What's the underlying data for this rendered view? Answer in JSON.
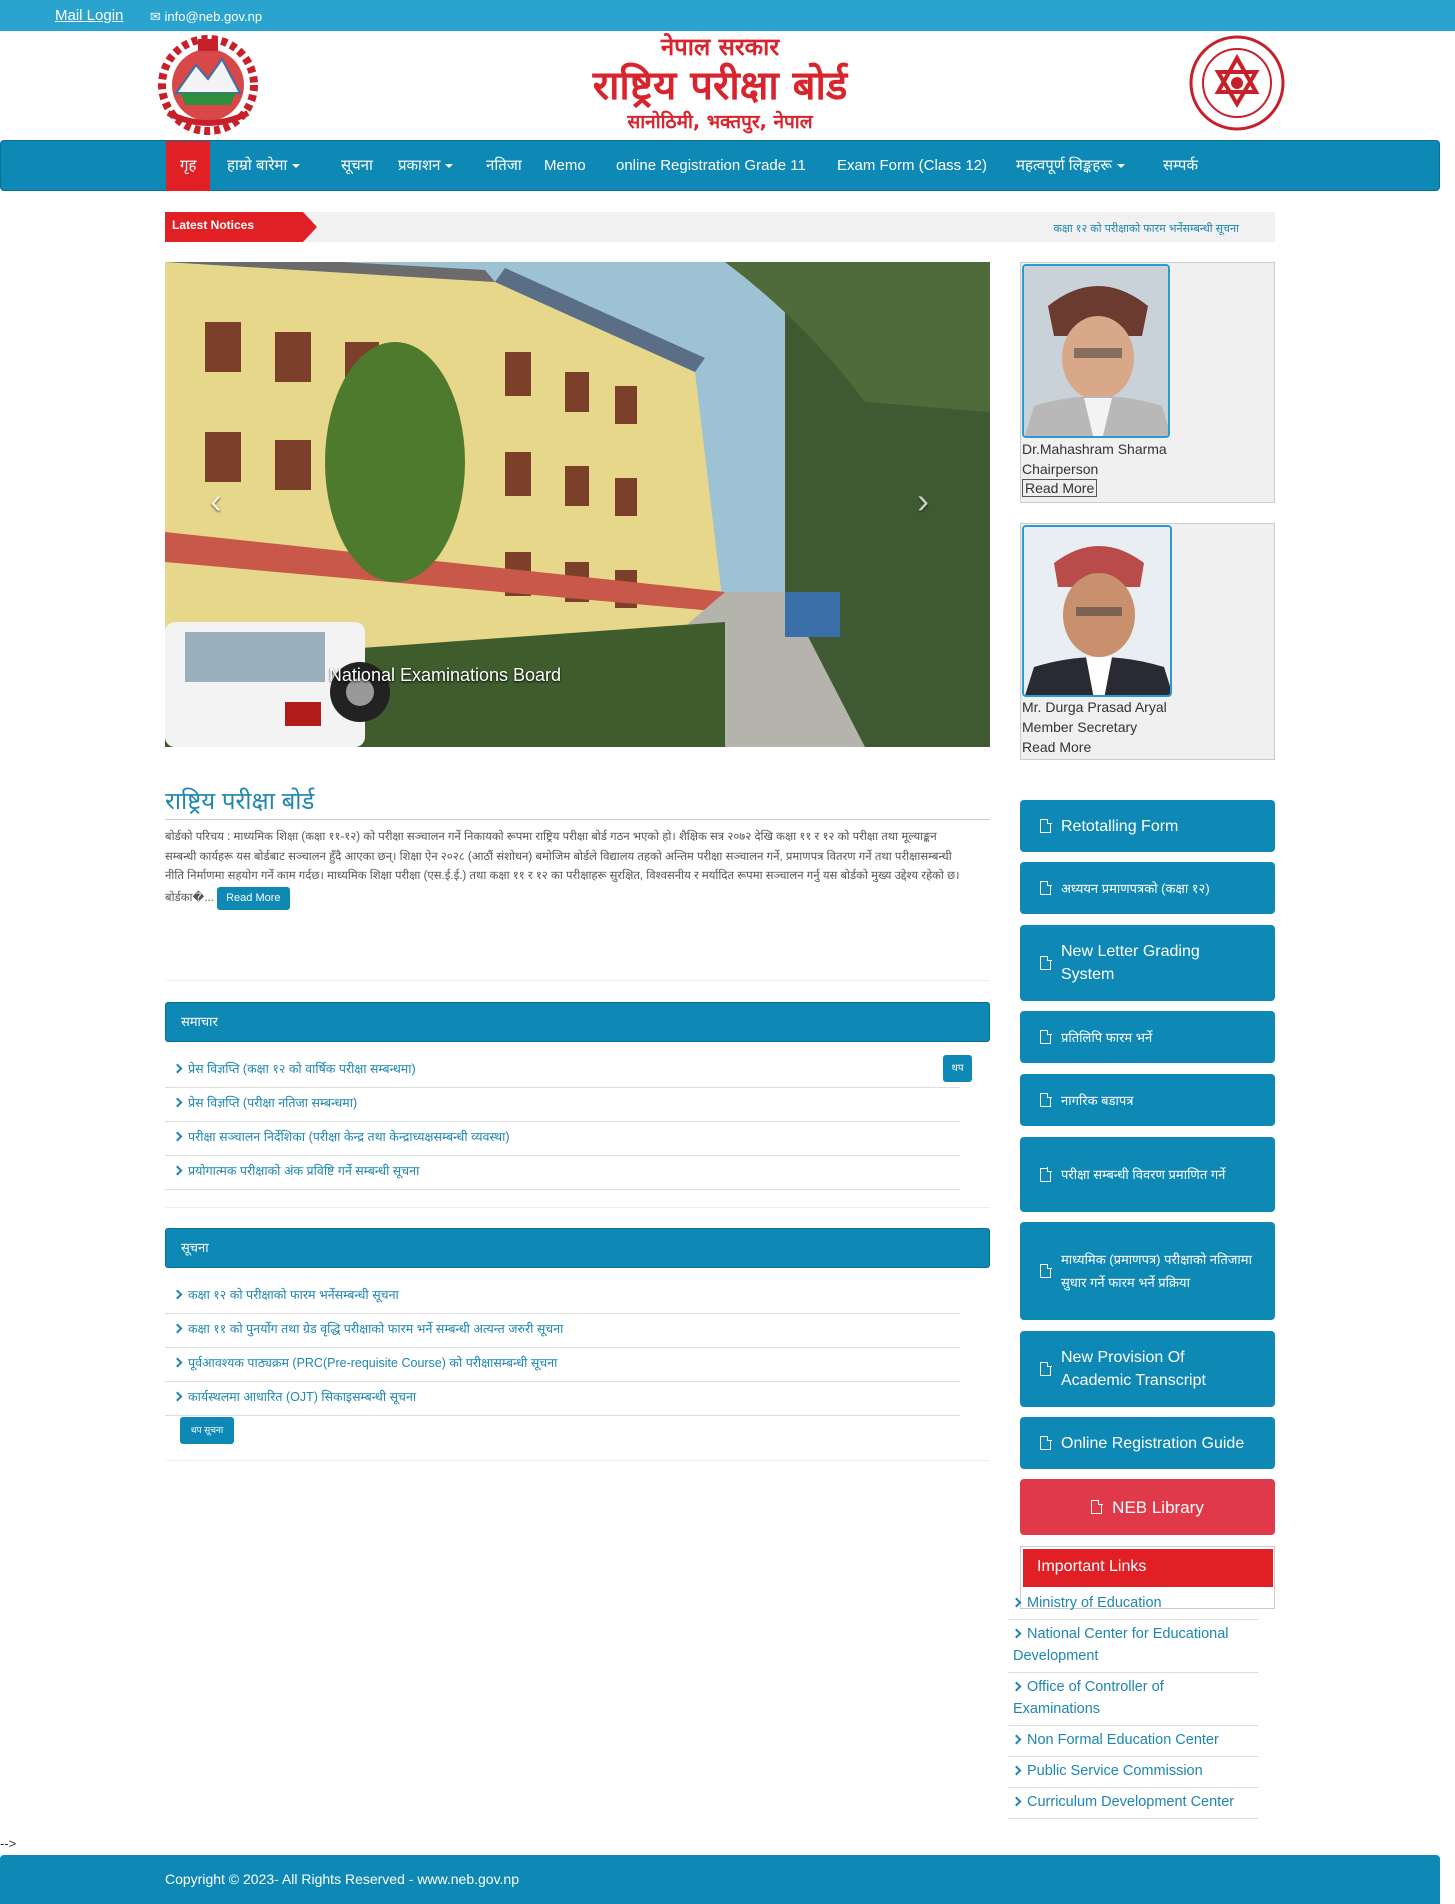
{
  "topbar": {
    "mail_login": "Mail Login",
    "email": "info@neb.gov.np"
  },
  "header": {
    "title_line1": "नेपाल सरकार",
    "title_line2": "राष्ट्रिय परीक्षा बोर्ड",
    "title_line3": "सानोठिमी, भक्तपुर, नेपाल"
  },
  "nav": [
    {
      "label": "गृह",
      "dropdown": false
    },
    {
      "label": "हाम्रो बारेमा",
      "dropdown": true
    },
    {
      "label": "सूचना",
      "dropdown": false
    },
    {
      "label": "प्रकाशन",
      "dropdown": true
    },
    {
      "label": "नतिजा",
      "dropdown": false
    },
    {
      "label": "Memo",
      "dropdown": false
    },
    {
      "label": "online Registration Grade 11",
      "dropdown": false
    },
    {
      "label": "Exam Form (Class 12)",
      "dropdown": false
    },
    {
      "label": "महत्वपूर्ण लिङ्कहरू",
      "dropdown": true
    },
    {
      "label": "सम्पर्क",
      "dropdown": false
    }
  ],
  "ticker": {
    "label": "Latest Notices",
    "text": "कक्षा १२ को परीक्षाको फारम भर्नेसम्बन्धी सूचना"
  },
  "carousel": {
    "caption": "National Examinations Board",
    "prev": "‹",
    "next": "›"
  },
  "profiles": [
    {
      "name": "Dr.Mahashram Sharma",
      "role": "Chairperson",
      "read_more": "Read More"
    },
    {
      "name": "Mr. Durga Prasad Aryal",
      "role": "Member Secretary",
      "read_more": "Read More"
    }
  ],
  "intro": {
    "title": "राष्ट्रिय परीक्षा बोर्ड",
    "text": "बोर्डको परिचय : माध्यमिक शिक्षा (कक्षा ११-१२) को परीक्षा सञ्चालन गर्ने निकायको रूपमा राष्ट्रिय परीक्षा बोर्ड गठन भएको हो। शैक्षिक सत्र २०७२ देखि कक्षा ११ र १२ को परीक्षा तथा मूल्याङ्कन सम्बन्धी कार्यहरू यस बोर्डबाट सञ्चालन हुँदै आएका छन्। शिक्षा ऐन २०२८ (आठौं संशोधन) बमोजिम बोर्डले विद्यालय तहको अन्तिम परीक्षा सञ्चालन गर्ने, प्रमाणपत्र वितरण गर्ने तथा परीक्षासम्बन्धी नीति निर्माणमा सहयोग गर्ने काम गर्दछ। माध्यमिक शिक्षा परीक्षा (एस.ई.ई.) तथा कक्षा ११ र १२ का परीक्षाहरू सुरक्षित, विश्वसनीय र मर्यादित रूपमा सञ्चालन गर्नु यस बोर्डको मुख्य उद्देश्य रहेको छ। बोर्डका�...",
    "read_more": "Read More"
  },
  "news": {
    "header": "समाचार",
    "more": "थप",
    "items": [
      "प्रेस विज्ञप्ति (कक्षा १२ को वार्षिक परीक्षा सम्बन्धमा)",
      "प्रेस विज्ञप्ति (परीक्षा नतिजा सम्बन्धमा)",
      "परीक्षा सञ्चालन निर्देशिका (परीक्षा केन्द्र तथा केन्द्राध्यक्षसम्बन्धी व्यवस्था)",
      "प्रयोगात्मक परीक्षाको अंक प्रविष्टि गर्ने सम्बन्धी सूचना"
    ]
  },
  "notices": {
    "header": "सूचना",
    "more": "थप सूचना",
    "items": [
      "कक्षा १२ को परीक्षाको फारम भर्नेसम्बन्धी सूचना",
      "कक्षा ११ को पुनर्योग तथा ग्रेड वृद्धि परीक्षाको फारम भर्ने सम्बन्धी अत्यन्त जरुरी सूचना",
      "पूर्वआवश्यक पाठ्यक्रम (PRC(Pre-requisite Course) को परीक्षासम्बन्धी सूचना",
      "कार्यस्थलमा आधारित (OJT) सिकाइसम्बन्धी सूचना"
    ]
  },
  "sidebar_buttons": [
    "Retotalling Form",
    "अध्ययन प्रमाणपत्रको (कक्षा १२)",
    "New Letter Grading System",
    "प्रतिलिपि फारम भर्ने",
    "नागरिक बडापत्र",
    "परीक्षा सम्बन्धी विवरण प्रमाणित गर्ने",
    "माध्यमिक (प्रमाणपत्र) परीक्षाको नतिजामा सुधार गर्ने फारम भर्ने प्रक्रिया",
    "New Provision Of Academic Transcript",
    "Online Registration Guide",
    "NEB Library"
  ],
  "important_links": {
    "header": "Important Links",
    "items": [
      "Ministry of Education",
      "National Center for Educational Development",
      "Office of Controller of Examinations",
      "Non Formal Education Center",
      "Public Service Commission",
      "Curriculum Development Center"
    ]
  },
  "stray_text": "-->",
  "footer": {
    "copyright": "Copyright © 2023- All Rights Reserved - www.neb.gov.np"
  },
  "colors": {
    "primary": "#0e88b5",
    "topbar": "#2aa3cf",
    "accent_red": "#e12025",
    "library_red": "#e03a4a",
    "link": "#1e86b0"
  }
}
